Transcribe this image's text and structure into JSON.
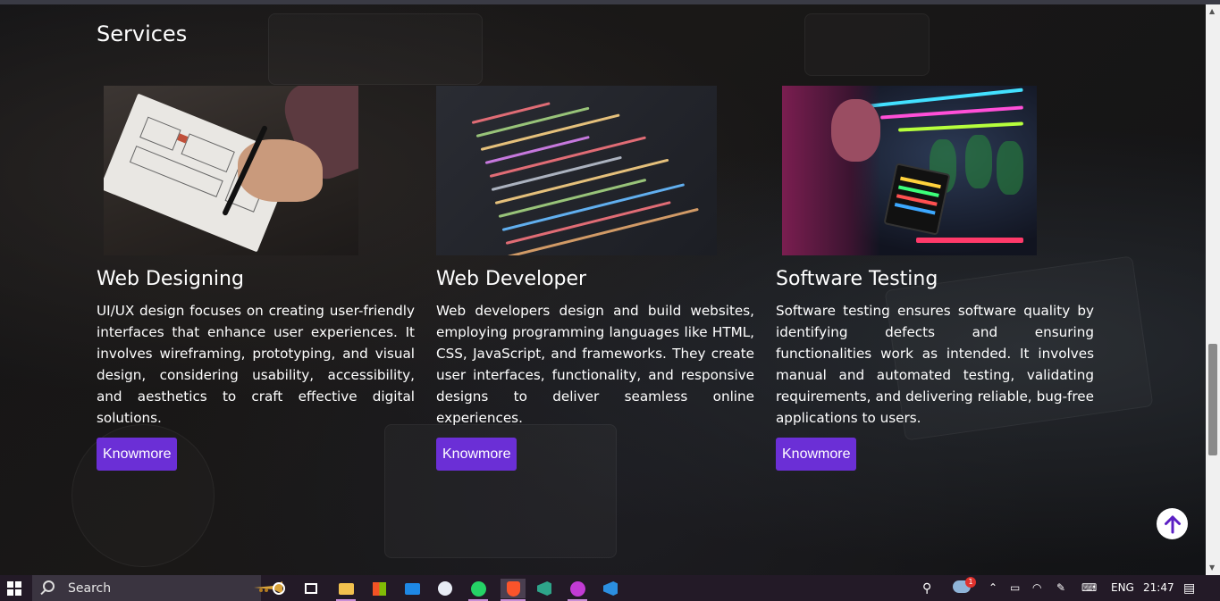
{
  "page": {
    "section_title": "Services",
    "cards": [
      {
        "title": "Web Designing",
        "description": "UI/UX design focuses on creating user-friendly interfaces that enhance user experiences. It involves wireframing, prototyping, and visual design, considering usability, accessibility, and aesthetics to craft effective digital solutions.",
        "button_label": "Knowmore"
      },
      {
        "title": "Web Developer",
        "description": "Web developers design and build websites, employing programming languages like HTML, CSS, JavaScript, and frameworks. They create user interfaces, functionality, and responsive designs to deliver seamless online experiences.",
        "button_label": "Knowmore"
      },
      {
        "title": "Software Testing",
        "description": "Software testing ensures software quality by identifying defects and ensuring functionalities work as intended. It involves manual and automated testing, validating requirements, and delivering reliable, bug-free applications to users.",
        "button_label": "Knowmore"
      }
    ],
    "scroll_top_icon": "arrow-up-icon",
    "accent_color": "#6b2fd6"
  },
  "taskbar": {
    "search_label": "Search",
    "language": "ENG",
    "time": "21:47",
    "weather_badge": "1",
    "icons": [
      "windows-icon",
      "search-icon",
      "cortana-icon",
      "task-view-icon",
      "file-explorer-icon",
      "store-icon",
      "mail-icon",
      "messenger-icon",
      "whatsapp-icon",
      "brave-icon",
      "visual-studio-icon",
      "app-w-icon",
      "vscode-icon"
    ]
  }
}
